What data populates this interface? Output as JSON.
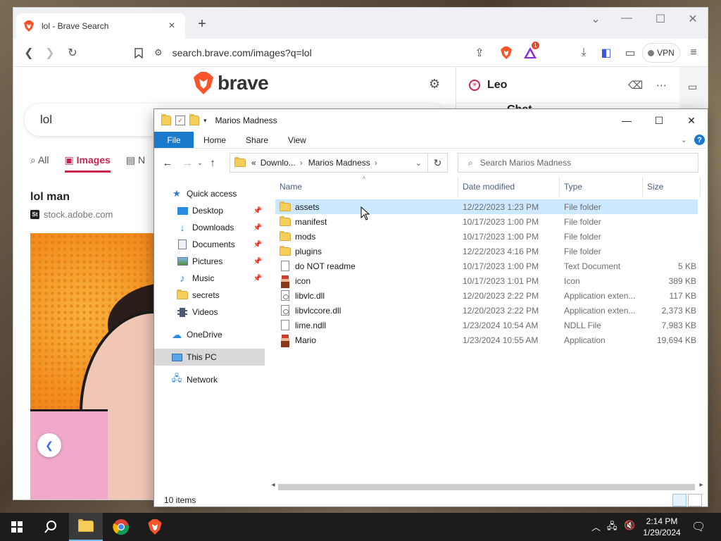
{
  "browser": {
    "tab_title": "lol - Brave Search",
    "url": "search.brave.com/images?q=lol",
    "vpn_label": "VPN",
    "rewards_badge": "1",
    "brand_color": "#fb542b"
  },
  "search_page": {
    "logo_text": "brave",
    "query": "lol",
    "tabs": [
      {
        "label": "All"
      },
      {
        "label": "Images"
      },
      {
        "label": "N"
      }
    ],
    "result_title": "lol man",
    "result_source": "stock.adobe.com",
    "source_badge": "St"
  },
  "leo": {
    "name": "Leo",
    "chat_label": "Chat"
  },
  "explorer": {
    "title": "Marios Madness",
    "ribbon": {
      "file": "File",
      "home": "Home",
      "share": "Share",
      "view": "View",
      "help": "?"
    },
    "address": {
      "prefix": "«",
      "seg1": "Downlo...",
      "seg2": "Marios Madness"
    },
    "search_placeholder": "Search Marios Madness",
    "nav": {
      "quick_access": "Quick access",
      "desktop": "Desktop",
      "downloads": "Downloads",
      "documents": "Documents",
      "pictures": "Pictures",
      "music": "Music",
      "secrets": "secrets",
      "videos": "Videos",
      "onedrive": "OneDrive",
      "this_pc": "This PC",
      "network": "Network"
    },
    "columns": {
      "name": "Name",
      "date": "Date modified",
      "type": "Type",
      "size": "Size"
    },
    "files": [
      {
        "name": "assets",
        "date": "12/22/2023 1:23 PM",
        "type": "File folder",
        "size": "",
        "icon": "folder-icon"
      },
      {
        "name": "manifest",
        "date": "10/17/2023 1:00 PM",
        "type": "File folder",
        "size": "",
        "icon": "folder-icon"
      },
      {
        "name": "mods",
        "date": "10/17/2023 1:00 PM",
        "type": "File folder",
        "size": "",
        "icon": "folder-icon"
      },
      {
        "name": "plugins",
        "date": "12/22/2023 4:16 PM",
        "type": "File folder",
        "size": "",
        "icon": "folder-icon"
      },
      {
        "name": "do NOT readme",
        "date": "10/17/2023 1:00 PM",
        "type": "Text Document",
        "size": "5 KB",
        "icon": "text-document-icon"
      },
      {
        "name": "icon",
        "date": "10/17/2023 1:01 PM",
        "type": "Icon",
        "size": "389 KB",
        "icon": "mario-icon"
      },
      {
        "name": "libvlc.dll",
        "date": "12/20/2023 2:22 PM",
        "type": "Application exten...",
        "size": "117 KB",
        "icon": "dll-icon"
      },
      {
        "name": "libvlccore.dll",
        "date": "12/20/2023 2:22 PM",
        "type": "Application exten...",
        "size": "2,373 KB",
        "icon": "dll-icon"
      },
      {
        "name": "lime.ndll",
        "date": "1/23/2024 10:54 AM",
        "type": "NDLL File",
        "size": "7,983 KB",
        "icon": "blank-file-icon"
      },
      {
        "name": "Mario",
        "date": "1/23/2024 10:55 AM",
        "type": "Application",
        "size": "19,694 KB",
        "icon": "mario-icon"
      }
    ],
    "status": "10 items"
  },
  "taskbar": {
    "time": "2:14 PM",
    "date": "1/29/2024"
  }
}
